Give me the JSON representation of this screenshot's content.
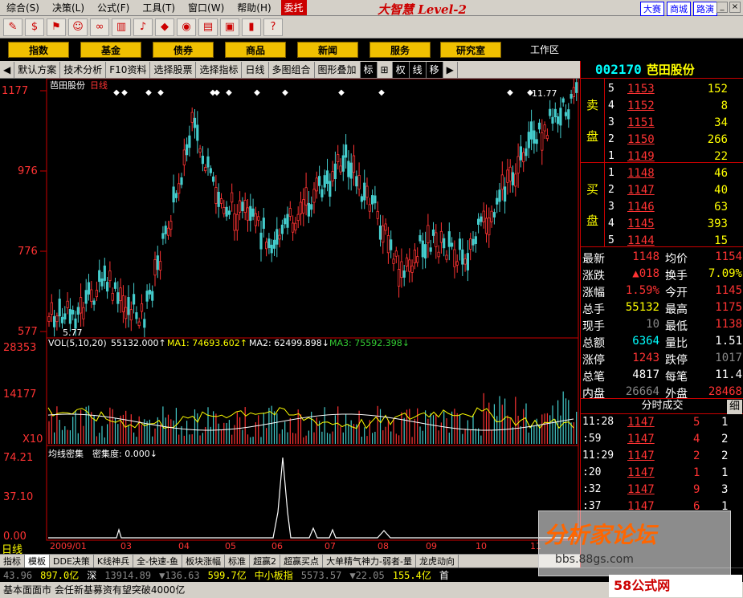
{
  "menu": [
    "综合(S)",
    "决策(L)",
    "公式(F)",
    "工具(T)",
    "窗口(W)",
    "帮助(H)"
  ],
  "menu_red": "委托",
  "brand": "大智慧 Level-2",
  "top_links": [
    "大赛",
    "商城",
    "路演"
  ],
  "nav": [
    "指数",
    "基金",
    "债券",
    "商品",
    "新闻",
    "服务",
    "研究室"
  ],
  "workarea": "工作区",
  "subbar": [
    "默认方案",
    "技术分析",
    "F10资料",
    "选择股票",
    "选择指标",
    "日线",
    "多图组合",
    "图形叠加",
    "标",
    "⊞",
    "权",
    "线",
    "移"
  ],
  "chart": {
    "stock_name": "芭田股份",
    "period": "日线",
    "y_labels": [
      "1177",
      "976",
      "776",
      "577"
    ],
    "max_label": "11.77",
    "min_label": "5.77",
    "vol_title": "VOL(5,10,20)",
    "vol_val": "55132.000↑",
    "ma1": "MA1: 74693.602↑",
    "ma2": "MA2: 62499.898↓",
    "ma3": "MA3: 75592.398↓",
    "vol_y": [
      "28353",
      "14177",
      "X10"
    ],
    "dens_title": "均线密集",
    "dens_sub": "密集度: 0.000↓",
    "dens_y": [
      "74.21",
      "37.10",
      "0.00"
    ],
    "months": [
      "日线",
      "2009/01",
      "03",
      "04",
      "05",
      "06",
      "07",
      "08",
      "09",
      "10",
      "11"
    ]
  },
  "quote": {
    "code": "002170",
    "name": "芭田股份",
    "sell_label": [
      "卖",
      "盘"
    ],
    "buy_label": [
      "买",
      "盘"
    ],
    "sell": [
      {
        "n": "5",
        "p": "1153",
        "v": "152"
      },
      {
        "n": "4",
        "p": "1152",
        "v": "8"
      },
      {
        "n": "3",
        "p": "1151",
        "v": "34"
      },
      {
        "n": "2",
        "p": "1150",
        "v": "266"
      },
      {
        "n": "1",
        "p": "1149",
        "v": "22"
      }
    ],
    "buy": [
      {
        "n": "1",
        "p": "1148",
        "v": "46"
      },
      {
        "n": "2",
        "p": "1147",
        "v": "40"
      },
      {
        "n": "3",
        "p": "1146",
        "v": "63"
      },
      {
        "n": "4",
        "p": "1145",
        "v": "393"
      },
      {
        "n": "5",
        "p": "1144",
        "v": "15"
      }
    ],
    "stats": [
      {
        "k1": "最新",
        "v1": "1148",
        "c1": "#f33",
        "k2": "均价",
        "v2": "1154",
        "c2": "#f33"
      },
      {
        "k1": "涨跌",
        "v1": "▲018",
        "c1": "#f33",
        "k2": "换手",
        "v2": "7.09%",
        "c2": "#ff0"
      },
      {
        "k1": "涨幅",
        "v1": "1.59%",
        "c1": "#f33",
        "k2": "今开",
        "v2": "1145",
        "c2": "#f33"
      },
      {
        "k1": "总手",
        "v1": "55132",
        "c1": "#ff0",
        "k2": "最高",
        "v2": "1175",
        "c2": "#f33"
      },
      {
        "k1": "现手",
        "v1": "10",
        "c1": "#888",
        "k2": "最低",
        "v2": "1138",
        "c2": "#f33"
      },
      {
        "k1": "总额",
        "v1": "6364",
        "c1": "#0ff",
        "k2": "量比",
        "v2": "1.51",
        "c2": "#fff"
      },
      {
        "k1": "涨停",
        "v1": "1243",
        "c1": "#f33",
        "k2": "跌停",
        "v2": "1017",
        "c2": "#888"
      },
      {
        "k1": "总笔",
        "v1": "4817",
        "c1": "#fff",
        "k2": "每笔",
        "v2": "11.4",
        "c2": "#fff"
      },
      {
        "k1": "内盘",
        "v1": "26664",
        "c1": "#888",
        "k2": "外盘",
        "v2": "28468",
        "c2": "#f33"
      }
    ],
    "ticks_title": "分时成交",
    "ticks_more": "细",
    "ticks": [
      {
        "t": "11:28",
        "p": "1147",
        "v": "5",
        "x": "1"
      },
      {
        "t": ":59",
        "p": "1147",
        "v": "4",
        "x": "2"
      },
      {
        "t": "11:29",
        "p": "1147",
        "v": "2",
        "x": "2"
      },
      {
        "t": ":20",
        "p": "1147",
        "v": "1",
        "x": "1"
      },
      {
        "t": ":32",
        "p": "1147",
        "v": "9",
        "x": "3"
      },
      {
        "t": ":37",
        "p": "1147",
        "v": "6",
        "x": "1"
      }
    ]
  },
  "bottom_tabs": [
    "指标",
    "模板",
    "DDE决策",
    "K线神兵",
    "全-快速-鱼",
    "板块涨幅",
    "标准",
    "超赢2",
    "超赢买点",
    "大单精气神力-弱者-量",
    "龙虎动向"
  ],
  "status": {
    "a": "43.96",
    "b": "897.0亿",
    "c": "深",
    "d": "13914.89",
    "e": "▼136.63",
    "f": "599.7亿",
    "g": "中小板指",
    "h": "5573.57",
    "i": "▼22.05",
    "j": "155.4亿",
    "k": "首"
  },
  "ticker": "基本面面市 会任新基募资有望突破4000亿",
  "watermark": {
    "t1": "分析家论坛",
    "t2": "bbs.88gs.com",
    "t3": "58公式网"
  }
}
